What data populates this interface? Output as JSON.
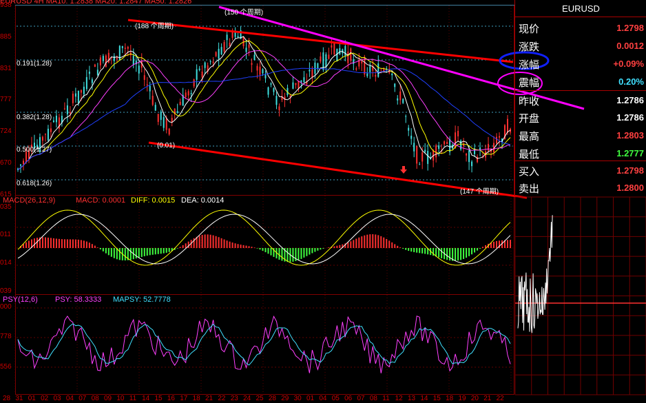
{
  "header": {
    "ma_label": "EURUSD 4H  MA10: 1.2838  MA20: 1.2847  MA50: 1.2826"
  },
  "price_axis": [
    "938",
    "885",
    "831",
    "777",
    "724",
    "670",
    "615"
  ],
  "fib_labels": [
    "0.191(1.28)",
    "0.382(1.28)",
    "0.500(1.27)",
    "0.618(1.26)"
  ],
  "annotations": {
    "period_150": "(150 个周期)",
    "period_188": "(188 个周期)",
    "period_147": "(147 个周期)",
    "low_label": "(0.01)"
  },
  "macd": {
    "label_name": "MACD(26,12,9)",
    "label_macd": "MACD: 0.0001",
    "label_diff": "DIFF: 0.0015",
    "label_dea": "DEA: 0.0014",
    "axis": [
      "035",
      "011",
      "014",
      "039"
    ]
  },
  "psy": {
    "label_name": "PSY(12,6)",
    "label_psy": "PSY: 58.3333",
    "label_mapsy": "MAPSY: 52.7778",
    "axis": [
      "000",
      "778",
      "556"
    ]
  },
  "x_labels": [
    "28",
    "31",
    "01",
    "02",
    "03",
    "04",
    "07",
    "08",
    "09",
    "10",
    "11",
    "14",
    "15",
    "16",
    "17",
    "18",
    "21",
    "22",
    "23",
    "24",
    "25",
    "28",
    "29",
    "30",
    "01",
    "04",
    "05",
    "06",
    "07",
    "08",
    "11",
    "12",
    "13",
    "14",
    "15",
    "18",
    "19",
    "20",
    "21",
    "22"
  ],
  "quote": {
    "symbol": "EURUSD",
    "rows": [
      {
        "label": "现价",
        "value": "1.2798",
        "color": "#ff4040"
      },
      {
        "label": "涨跌",
        "value": "0.0012",
        "color": "#ff4040"
      },
      {
        "label": "涨幅",
        "value": "+0.09%",
        "color": "#ff4040"
      },
      {
        "label": "震幅",
        "value": "0.20%",
        "color": "#40e0ff"
      },
      {
        "label": "昨收",
        "value": "1.2786",
        "color": "#ffffff"
      },
      {
        "label": "开盘",
        "value": "1.2786",
        "color": "#ffffff"
      },
      {
        "label": "最高",
        "value": "1.2803",
        "color": "#ff4040"
      },
      {
        "label": "最低",
        "value": "1.2777",
        "color": "#40ff40"
      },
      {
        "label": "买入",
        "value": "1.2798",
        "color": "#ff4040"
      },
      {
        "label": "卖出",
        "value": "1.2800",
        "color": "#ff4040"
      }
    ]
  },
  "colors": {
    "up": "#ff3030",
    "down": "#40e0e0",
    "grid": "#800000",
    "ma10": "#ffffff",
    "ma20": "#ffff00",
    "ma50": "#ff40ff",
    "ma60": "#2040ff",
    "trend_red": "#ff0000",
    "trend_magenta": "#ff00ff",
    "ellipse_blue": "#1020ff",
    "ellipse_magenta": "#ff00ff"
  }
}
